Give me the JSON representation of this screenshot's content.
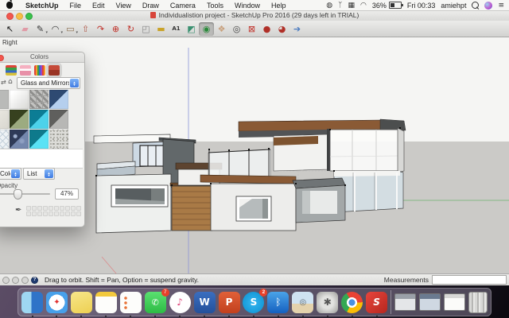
{
  "menu_bar": {
    "items": [
      "SketchUp",
      "File",
      "Edit",
      "View",
      "Draw",
      "Camera",
      "Tools",
      "Window",
      "Help"
    ],
    "status_icons": [
      {
        "name": "screen-recording-icon",
        "glyph": "◍"
      },
      {
        "name": "airport-icon",
        "glyph": "ᛉ"
      },
      {
        "name": "display-icon",
        "glyph": "▦"
      },
      {
        "name": "wifi-icon",
        "glyph": "◠"
      }
    ],
    "battery_percent": "36%",
    "clock": "Fri 00:33",
    "user": "amiehpt",
    "notification_glyph": "≡"
  },
  "window": {
    "title": "Individualistion project - SketchUp Pro 2016 (29 days left in TRIAL)"
  },
  "toolbar": {
    "tools": [
      {
        "name": "select-tool",
        "glyph": "↖",
        "color": "#111111",
        "dropdown": false,
        "active": false
      },
      {
        "name": "eraser-tool",
        "glyph": "▰",
        "color": "#e09aa6",
        "dropdown": false,
        "active": false
      },
      {
        "name": "line-tool",
        "glyph": "✎",
        "color": "#333333",
        "dropdown": true,
        "active": false
      },
      {
        "name": "arc-tool",
        "glyph": "◠",
        "color": "#333333",
        "dropdown": true,
        "active": false
      },
      {
        "name": "rectangle-tool",
        "glyph": "▭",
        "color": "#8a6b4a",
        "dropdown": true,
        "active": false
      },
      {
        "name": "push-pull-tool",
        "glyph": "⇧",
        "color": "#b05a4a",
        "dropdown": false,
        "active": false
      },
      {
        "name": "follow-me-tool",
        "glyph": "↷",
        "color": "#c03028",
        "dropdown": false,
        "active": false
      },
      {
        "name": "move-tool",
        "glyph": "⊕",
        "color": "#c03028",
        "dropdown": false,
        "active": false
      },
      {
        "name": "rotate-tool",
        "glyph": "↻",
        "color": "#c03028",
        "dropdown": false,
        "active": false
      },
      {
        "name": "scale-tool",
        "glyph": "◰",
        "color": "#888888",
        "dropdown": false,
        "active": false
      },
      {
        "name": "tape-measure-tool",
        "glyph": "▬",
        "color": "#c9a227",
        "dropdown": false,
        "active": false
      },
      {
        "name": "text-tool",
        "glyph": "A1",
        "color": "#333333",
        "dropdown": false,
        "active": false,
        "text": true
      },
      {
        "name": "paint-bucket-tool",
        "glyph": "◩",
        "color": "#3a9070",
        "dropdown": false,
        "active": false
      },
      {
        "name": "orbit-tool",
        "glyph": "◉",
        "color": "#2a8a3a",
        "dropdown": false,
        "active": true
      },
      {
        "name": "pan-tool",
        "glyph": "❖",
        "color": "#c8a07c",
        "dropdown": false,
        "active": false
      },
      {
        "name": "zoom-tool",
        "glyph": "◎",
        "color": "#444444",
        "dropdown": false,
        "active": false
      },
      {
        "name": "zoom-extents-tool",
        "glyph": "⊠",
        "color": "#c03028",
        "dropdown": false,
        "active": false
      },
      {
        "name": "position-camera-tool",
        "glyph": "●",
        "color": "#b03028",
        "dropdown": false,
        "active": false
      },
      {
        "name": "look-around-tool",
        "glyph": "◕",
        "color": "#b03028",
        "dropdown": false,
        "active": false
      },
      {
        "name": "walk-tool",
        "glyph": "➔",
        "color": "#4a7ac0",
        "dropdown": false,
        "active": false
      }
    ]
  },
  "viewport": {
    "scene_label": "Right",
    "axis_colors": {
      "red": "#d89090",
      "green": "#86b886",
      "blue": "#8b93d6"
    }
  },
  "colors_panel": {
    "title": "Colors",
    "tabs": [
      {
        "name": "color-wheel-tab",
        "style": "tab-wheel",
        "selected": false
      },
      {
        "name": "color-sliders-tab",
        "style": "tab-crayons",
        "selected": false
      },
      {
        "name": "color-pencils-tab",
        "style": "tab-pencils",
        "selected": false
      },
      {
        "name": "texture-palettes-tab",
        "style": "tab-brick",
        "selected": true
      }
    ],
    "nav_glyph": "⇄",
    "home_glyph": "⌂",
    "collection_dropdown": "Glass and Mirrors",
    "swatch_rows": [
      [
        "sw-solid-gray",
        "sw-white-grad",
        "sw-tile-tex",
        "sw-diag-navy"
      ],
      [
        "sw-tex-light",
        "sw-diag-olive",
        "sw-diag-teal",
        "sw-diag-gray"
      ],
      [
        "sw-lattice",
        "sw-tex-navy",
        "sw-diag-cyan",
        "sw-speckle"
      ]
    ],
    "palette_dropdown": "Color",
    "view_dropdown": "List",
    "opacity_label": "Opacity",
    "opacity_value": "47%",
    "dropper_glyph": "✒"
  },
  "status_bar": {
    "icons": [
      {
        "name": "geolocation-icon",
        "glyph": "",
        "help": false
      },
      {
        "name": "claim-credit-icon",
        "glyph": "",
        "help": false
      },
      {
        "name": "model-info-icon",
        "glyph": "",
        "help": false
      },
      {
        "name": "help-icon",
        "glyph": "?",
        "help": true
      }
    ],
    "hint": "Drag to orbit. Shift = Pan, Option = suspend gravity.",
    "measurements_label": "Measurements",
    "measurements_value": ""
  },
  "dock": {
    "items": [
      {
        "name": "finder",
        "label": "Finder",
        "glyph": "",
        "dot": true
      },
      {
        "name": "safari",
        "label": "Safari",
        "glyph": "✦",
        "dot": true
      },
      {
        "name": "stickies",
        "label": "Stickies",
        "glyph": "",
        "dot": true
      },
      {
        "name": "notes",
        "label": "Notes",
        "glyph": "",
        "dot": true
      },
      {
        "name": "reminders",
        "label": "Reminders",
        "glyph": "",
        "dot": true
      },
      {
        "name": "facetime",
        "label": "FaceTime",
        "glyph": "✆",
        "badge": "7",
        "dot": true
      },
      {
        "name": "itunes",
        "label": "iTunes",
        "glyph": "♪",
        "dot": true
      },
      {
        "name": "word",
        "label": "Microsoft Word",
        "glyph": "W",
        "dot": true
      },
      {
        "name": "powerpoint",
        "label": "Microsoft PowerPoint",
        "glyph": "P",
        "dot": true
      },
      {
        "name": "skype",
        "label": "Skype",
        "glyph": "S",
        "badge": "2",
        "dot": true
      },
      {
        "name": "bluetooth",
        "label": "Bluetooth File Exchange",
        "glyph": "ᛒ",
        "dot": true
      },
      {
        "name": "photos",
        "label": "Photos",
        "glyph": "◎",
        "dot": true
      },
      {
        "name": "system-preferences",
        "label": "System Preferences",
        "glyph": "✱",
        "dot": true
      },
      {
        "name": "chrome",
        "label": "Google Chrome",
        "glyph": "",
        "dot": true
      },
      {
        "name": "sketchup",
        "label": "SketchUp",
        "glyph": "S",
        "dot": true
      },
      {
        "name": "divider"
      },
      {
        "name": "window-min-1",
        "label": "Minimized Window",
        "glyph": ""
      },
      {
        "name": "window-min-2",
        "label": "Minimized Window",
        "glyph": ""
      },
      {
        "name": "window-min-3",
        "label": "Minimized Window",
        "glyph": ""
      },
      {
        "name": "trash",
        "label": "Trash",
        "glyph": ""
      }
    ]
  }
}
